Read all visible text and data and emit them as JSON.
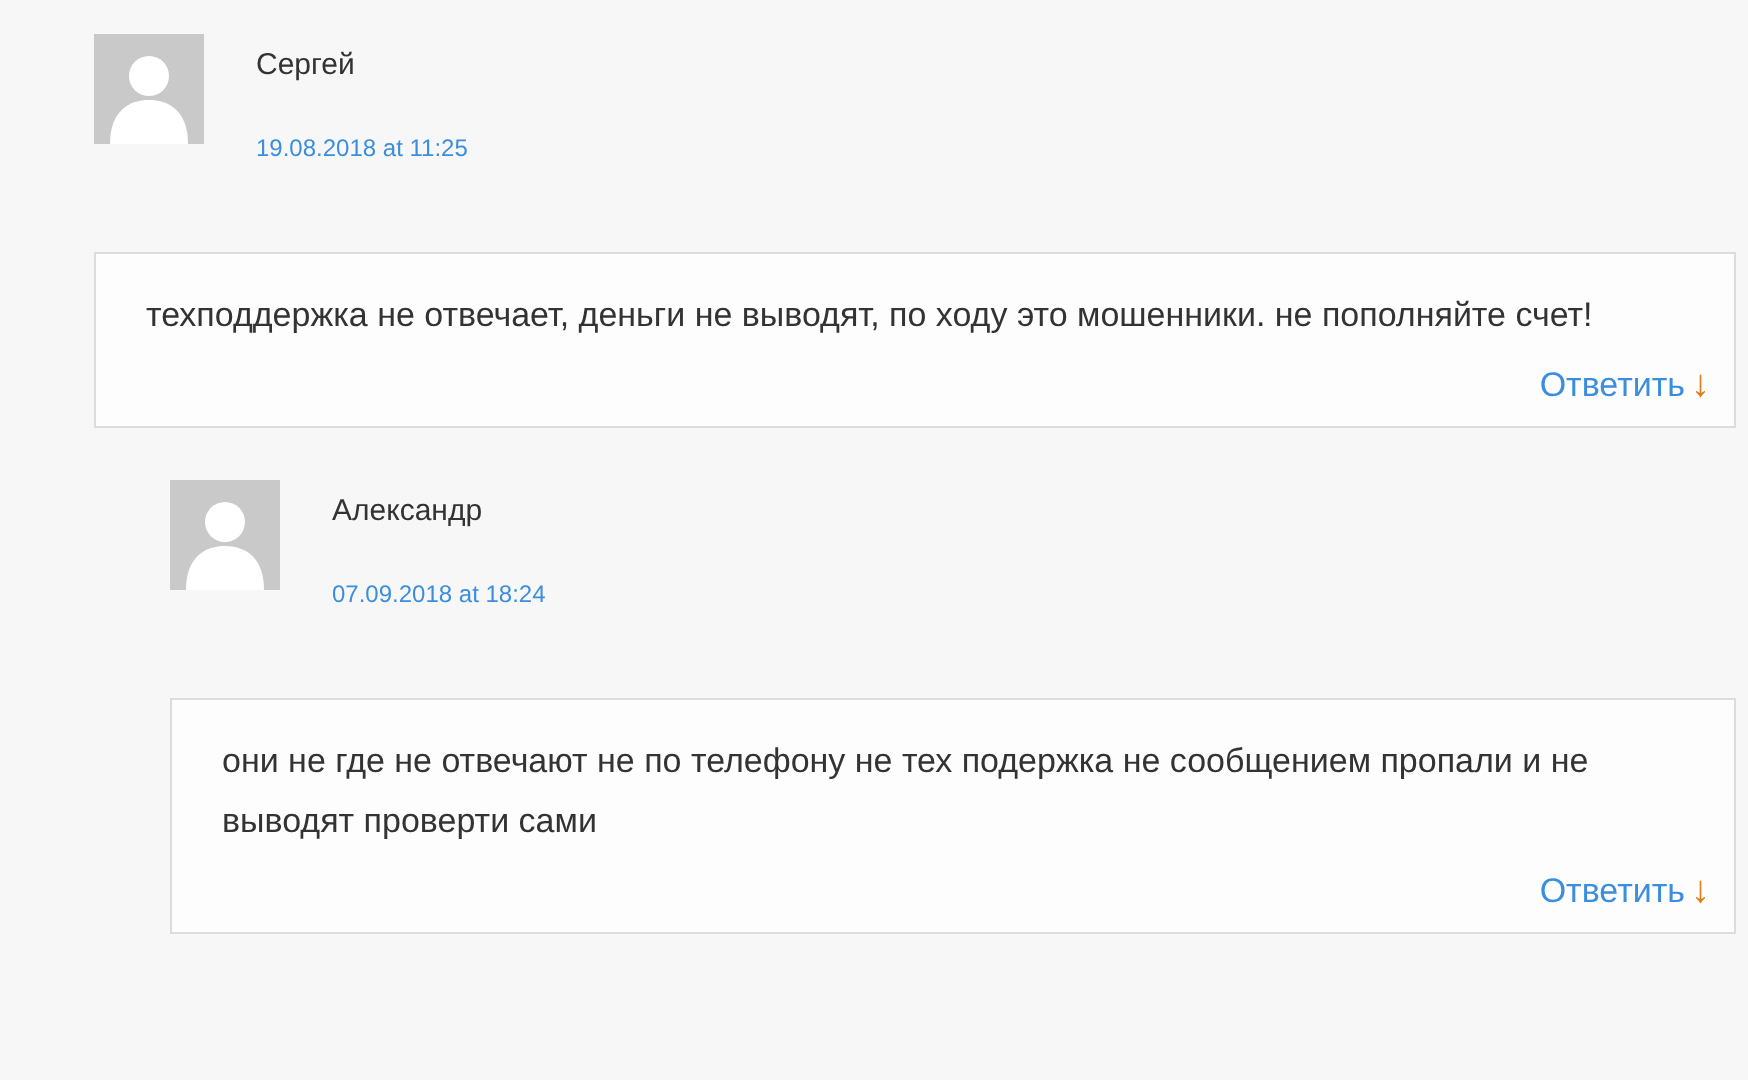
{
  "comments": [
    {
      "author": "Сергей",
      "date": "19.08.2018 at 11:25",
      "text": "техподдержка не отвечает, деньги не выводят, по ходу это мошенники. не пополняйте счет!",
      "reply_label": "Ответить",
      "reply_icon": "↓",
      "children": [
        {
          "author": "Александр",
          "date": "07.09.2018 at 18:24",
          "text": "они не где не отвечают не по телефону не тех подержка не сообщением пропали и не выводят проверти сами",
          "reply_label": "Ответить",
          "reply_icon": "↓"
        }
      ]
    }
  ]
}
